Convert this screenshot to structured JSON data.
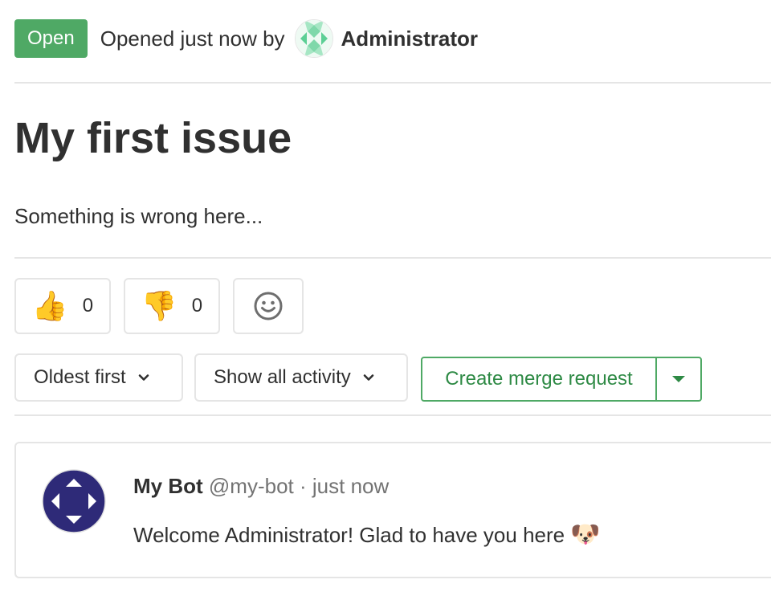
{
  "header": {
    "status": "Open",
    "opened_text": "Opened just now by",
    "author": "Administrator"
  },
  "issue": {
    "title": "My first issue",
    "description": "Something is wrong here..."
  },
  "awards": [
    {
      "emoji": "👍",
      "count": "0",
      "icon": "thumbs-up-icon"
    },
    {
      "emoji": "👎",
      "count": "0",
      "icon": "thumbs-down-icon"
    },
    {
      "icon": "smiley-icon"
    }
  ],
  "controls": {
    "sort_label": "Oldest first",
    "filter_label": "Show all activity",
    "merge_request_label": "Create merge request"
  },
  "note": {
    "author_name": "My Bot",
    "author_handle": "@my-bot",
    "separator": "·",
    "time": "just now",
    "body": "Welcome Administrator! Glad to have you here",
    "emoji": "🐶"
  },
  "colors": {
    "status_green": "#4fa965",
    "merge_green": "#2e8a45",
    "border": "#e5e5e5",
    "bot_avatar": "#2e2a78"
  }
}
